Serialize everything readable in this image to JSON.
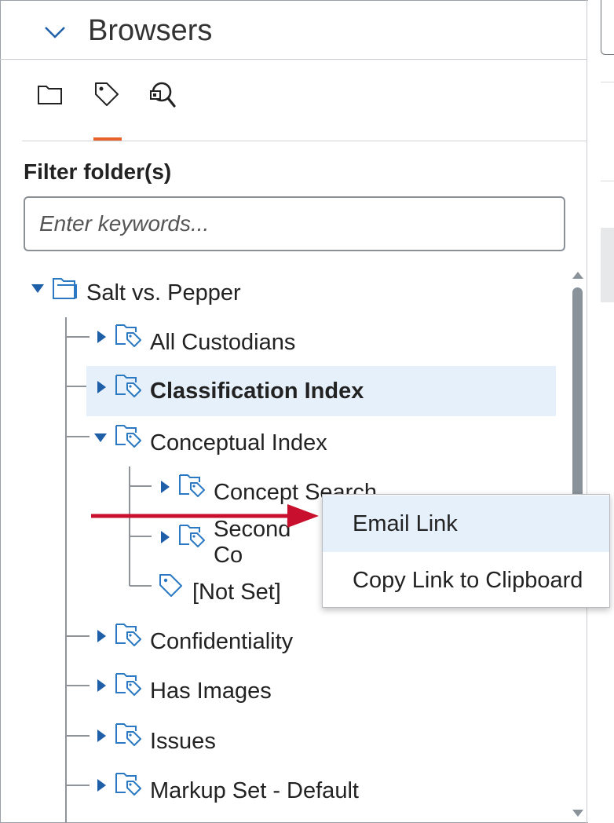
{
  "header": {
    "title": "Browsers"
  },
  "tabs": [
    {
      "name": "folder-tab",
      "icon": "folder-icon"
    },
    {
      "name": "tag-tab",
      "icon": "tag-icon",
      "active": true
    },
    {
      "name": "search-tab",
      "icon": "saved-search-icon"
    }
  ],
  "filter": {
    "label": "Filter folder(s)",
    "placeholder": "Enter keywords..."
  },
  "tree": {
    "root": "Salt vs. Pepper",
    "items": [
      {
        "label": "All Custodians"
      },
      {
        "label": "Classification Index",
        "selected": true
      },
      {
        "label": "Conceptual Index",
        "expanded": true
      },
      {
        "label": "Concept Search"
      },
      {
        "label": "Second Co"
      },
      {
        "label": "[Not Set]"
      },
      {
        "label": "Confidentiality"
      },
      {
        "label": "Has Images"
      },
      {
        "label": "Issues"
      },
      {
        "label": "Markup Set - Default"
      }
    ]
  },
  "context_menu": {
    "items": [
      {
        "label": "Email Link"
      },
      {
        "label": "Copy Link to Clipboard"
      }
    ]
  },
  "colors": {
    "accent": "#e8622c",
    "selected_bg": "#e6f0fb",
    "caret": "#1f5fa8",
    "arrow": "#c8102e"
  }
}
